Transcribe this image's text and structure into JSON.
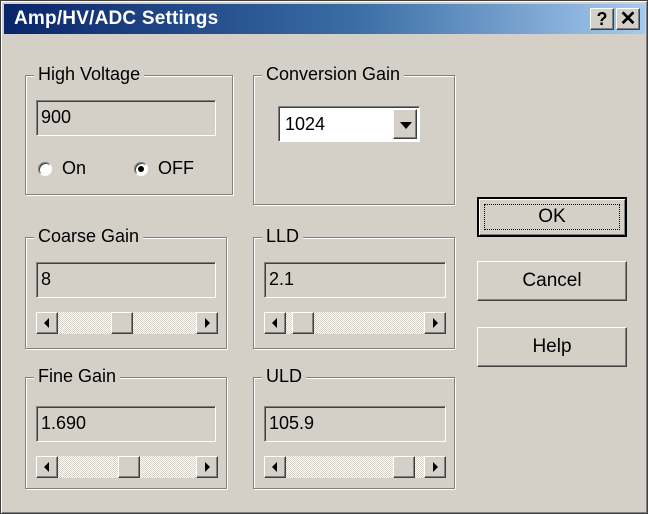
{
  "window": {
    "title": "Amp/HV/ADC Settings",
    "help_glyph": "?",
    "close_glyph": "✕",
    "colors": {
      "titlebar_start": "#0a246a",
      "titlebar_end": "#a6caf0",
      "face": "#d4d0c8"
    }
  },
  "high_voltage": {
    "label": "High Voltage",
    "value": "900",
    "on_label": "On",
    "off_label": "OFF",
    "selected": "OFF"
  },
  "conversion_gain": {
    "label": "Conversion Gain",
    "value": "1024"
  },
  "coarse_gain": {
    "label": "Coarse Gain",
    "value": "8",
    "slider_fraction": 0.46
  },
  "lld": {
    "label": "LLD",
    "value": "2.1",
    "slider_fraction": 0.05
  },
  "fine_gain": {
    "label": "Fine Gain",
    "value": "1.690",
    "slider_fraction": 0.52
  },
  "uld": {
    "label": "ULD",
    "value": "105.9",
    "slider_fraction": 0.92
  },
  "buttons": {
    "ok": "OK",
    "cancel": "Cancel",
    "help": "Help"
  }
}
